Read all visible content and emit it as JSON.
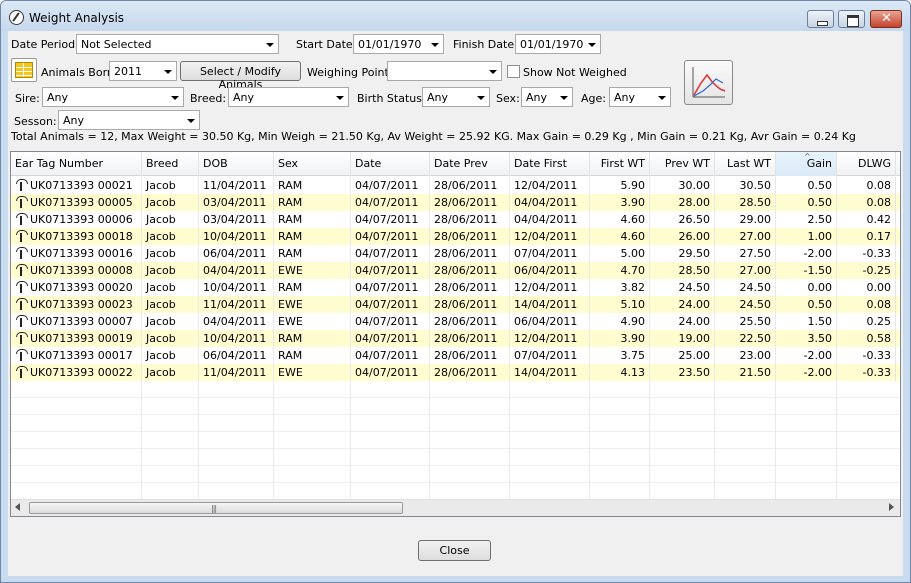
{
  "window": {
    "title": "Weight Analysis"
  },
  "filters": {
    "date_period_label": "Date Period:",
    "date_period_value": "Not Selected",
    "start_date_label": "Start Date:",
    "start_date_value": "01/01/1970",
    "finish_date_label": "Finish Date:",
    "finish_date_value": "01/01/1970",
    "animals_born_label": "Animals Born:",
    "animals_born_value": "2011",
    "select_modify_label": "Select / Modify Animals",
    "weighing_point_label": "Weighing Point:",
    "weighing_point_value": "",
    "show_not_weighed_label": "Show Not Weighed",
    "sire_label": "Sire:",
    "sire_value": "Any",
    "breed_label": "Breed:",
    "breed_value": "Any",
    "birth_status_label": "Birth Status:",
    "birth_status_value": "Any",
    "sex_label": "Sex:",
    "sex_value": "Any",
    "age_label": "Age:",
    "age_value": "Any",
    "season_label": "Sesson:",
    "season_value": "Any"
  },
  "summary": "Total Animals = 12, Max Weight = 30.50 Kg, Min Weigh = 21.50 Kg, Av Weight = 25.92 KG. Max Gain = 0.29 Kg , Min Gain = 0.21 Kg, Avr Gain = 0.24 Kg",
  "table": {
    "columns": [
      "Ear Tag Number",
      "Breed",
      "DOB",
      "Sex",
      "Date",
      "Date Prev",
      "Date First",
      "First WT",
      "Prev WT",
      "Last WT",
      "Gain",
      "DLWG"
    ],
    "sorted_column": "Gain",
    "rows": [
      [
        "UK0713393 00021",
        "Jacob",
        "11/04/2011",
        "RAM",
        "04/07/2011",
        "28/06/2011",
        "12/04/2011",
        "5.90",
        "30.00",
        "30.50",
        "0.50",
        "0.08"
      ],
      [
        "UK0713393 00005",
        "Jacob",
        "03/04/2011",
        "RAM",
        "04/07/2011",
        "28/06/2011",
        "04/04/2011",
        "3.90",
        "28.00",
        "28.50",
        "0.50",
        "0.08"
      ],
      [
        "UK0713393 00006",
        "Jacob",
        "03/04/2011",
        "RAM",
        "04/07/2011",
        "28/06/2011",
        "04/04/2011",
        "4.60",
        "26.50",
        "29.00",
        "2.50",
        "0.42"
      ],
      [
        "UK0713393 00018",
        "Jacob",
        "10/04/2011",
        "RAM",
        "04/07/2011",
        "28/06/2011",
        "12/04/2011",
        "4.60",
        "26.00",
        "27.00",
        "1.00",
        "0.17"
      ],
      [
        "UK0713393 00016",
        "Jacob",
        "06/04/2011",
        "RAM",
        "04/07/2011",
        "28/06/2011",
        "07/04/2011",
        "5.00",
        "29.50",
        "27.50",
        "-2.00",
        "-0.33"
      ],
      [
        "UK0713393 00008",
        "Jacob",
        "04/04/2011",
        "EWE",
        "04/07/2011",
        "28/06/2011",
        "06/04/2011",
        "4.70",
        "28.50",
        "27.00",
        "-1.50",
        "-0.25"
      ],
      [
        "UK0713393 00020",
        "Jacob",
        "10/04/2011",
        "RAM",
        "04/07/2011",
        "28/06/2011",
        "12/04/2011",
        "3.82",
        "24.50",
        "24.50",
        "0.00",
        "0.00"
      ],
      [
        "UK0713393 00023",
        "Jacob",
        "11/04/2011",
        "EWE",
        "04/07/2011",
        "28/06/2011",
        "14/04/2011",
        "5.10",
        "24.00",
        "24.50",
        "0.50",
        "0.08"
      ],
      [
        "UK0713393 00007",
        "Jacob",
        "04/04/2011",
        "EWE",
        "04/07/2011",
        "28/06/2011",
        "06/04/2011",
        "4.90",
        "24.00",
        "25.50",
        "1.50",
        "0.25"
      ],
      [
        "UK0713393 00019",
        "Jacob",
        "10/04/2011",
        "RAM",
        "04/07/2011",
        "28/06/2011",
        "12/04/2011",
        "3.90",
        "19.00",
        "22.50",
        "3.50",
        "0.58"
      ],
      [
        "UK0713393 00017",
        "Jacob",
        "06/04/2011",
        "RAM",
        "04/07/2011",
        "28/06/2011",
        "07/04/2011",
        "3.75",
        "25.00",
        "23.00",
        "-2.00",
        "-0.33"
      ],
      [
        "UK0713393 00022",
        "Jacob",
        "11/04/2011",
        "EWE",
        "04/07/2011",
        "28/06/2011",
        "14/04/2011",
        "4.13",
        "23.50",
        "21.50",
        "-2.00",
        "-0.33"
      ]
    ]
  },
  "footer": {
    "close_label": "Close"
  },
  "colors": {
    "alt_row": "#fffdd0",
    "window_frame": "#c9dcef"
  }
}
